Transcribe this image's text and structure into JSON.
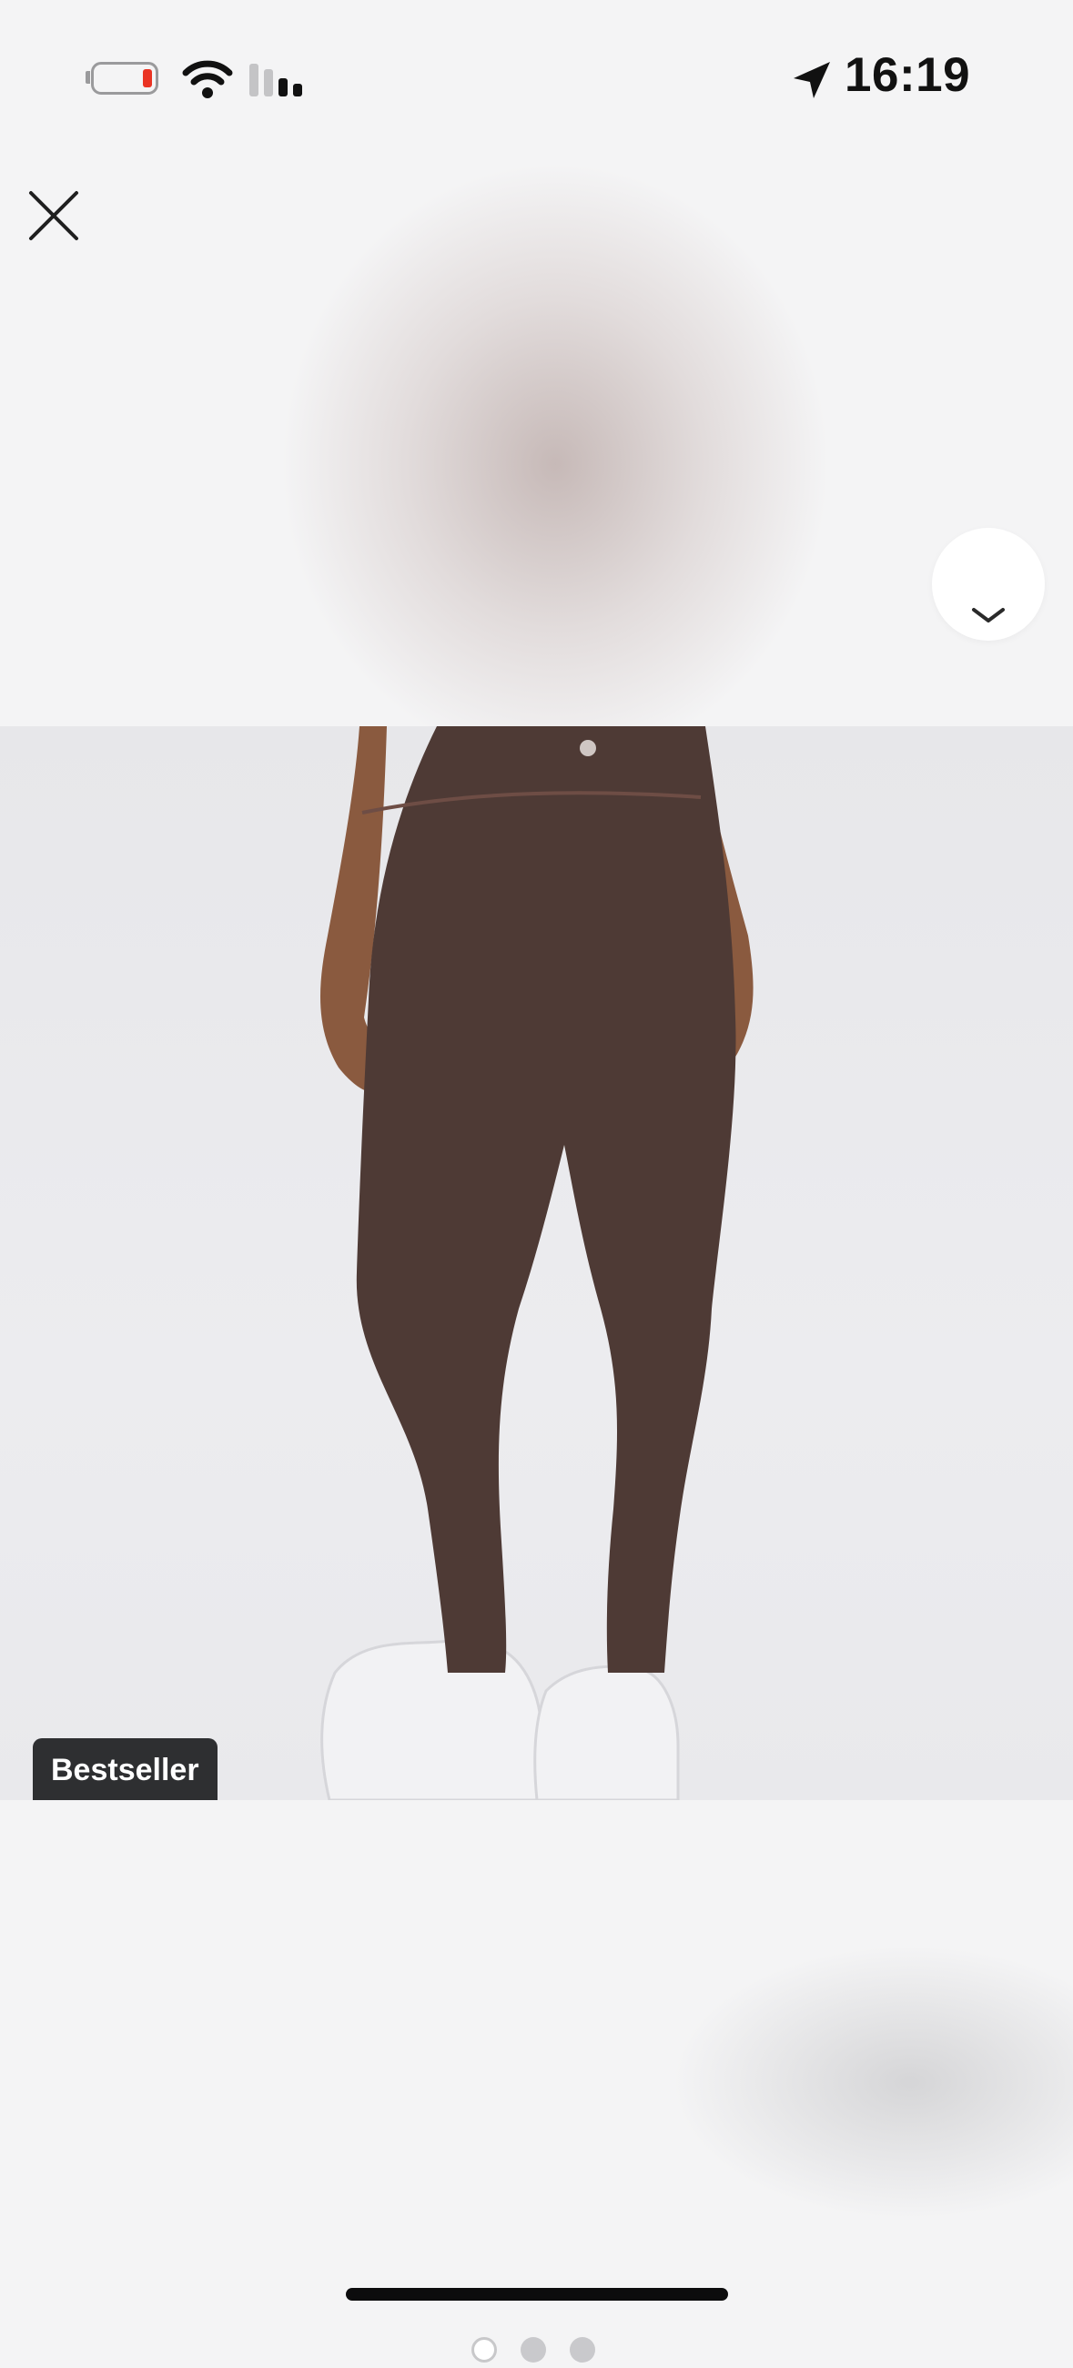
{
  "status_bar": {
    "time": "16:19",
    "battery_color": "#ea3323",
    "icons": [
      "battery-low-icon",
      "wifi-icon",
      "cellular-signal-icon",
      "location-arrow-icon"
    ]
  },
  "toolbar": {
    "close_icon": "close-icon",
    "collapse_icon": "chevron-down-icon"
  },
  "gallery": {
    "badge": "Bestseller",
    "page_count": 3,
    "current_page": 1,
    "product_color": "#4e3a35"
  }
}
